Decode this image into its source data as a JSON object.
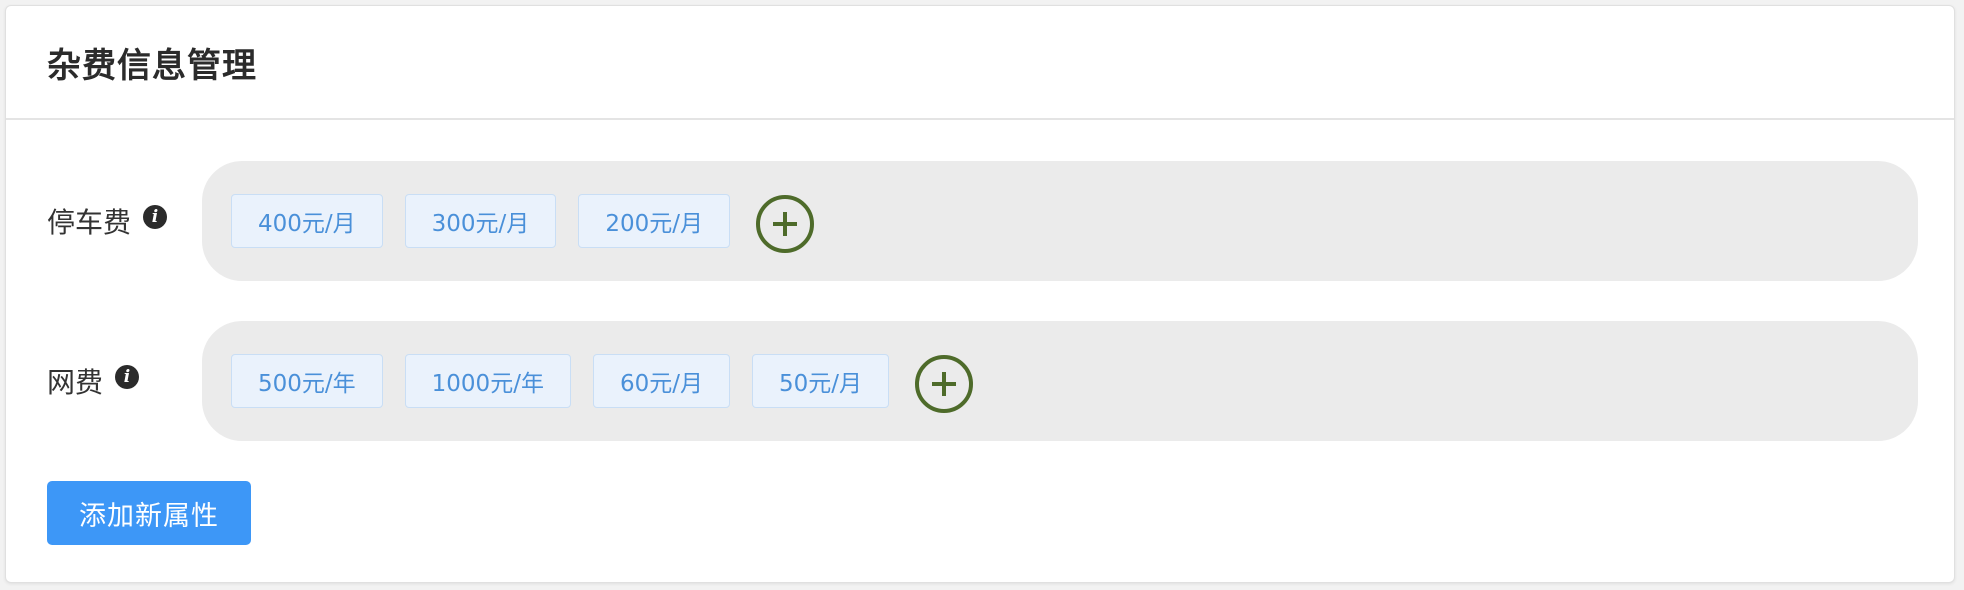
{
  "header": {
    "title": "杂费信息管理"
  },
  "attributes": [
    {
      "label": "停车费",
      "info_icon": "info-icon",
      "tags": [
        "400元/月",
        "300元/月",
        "200元/月"
      ],
      "add_icon": "plus-circle-icon"
    },
    {
      "label": "网费",
      "info_icon": "info-icon",
      "tags": [
        "500元/年",
        "1000元/年",
        "60元/月",
        "50元/月"
      ],
      "add_icon": "plus-circle-icon"
    }
  ],
  "footer": {
    "add_attribute_label": "添加新属性"
  },
  "colors": {
    "accent": "#3d97f7",
    "tag_text": "#4a90d9",
    "tag_bg": "#eaf2fc",
    "pill_bg": "#ebebeb",
    "add_icon": "#4e6b2a"
  }
}
